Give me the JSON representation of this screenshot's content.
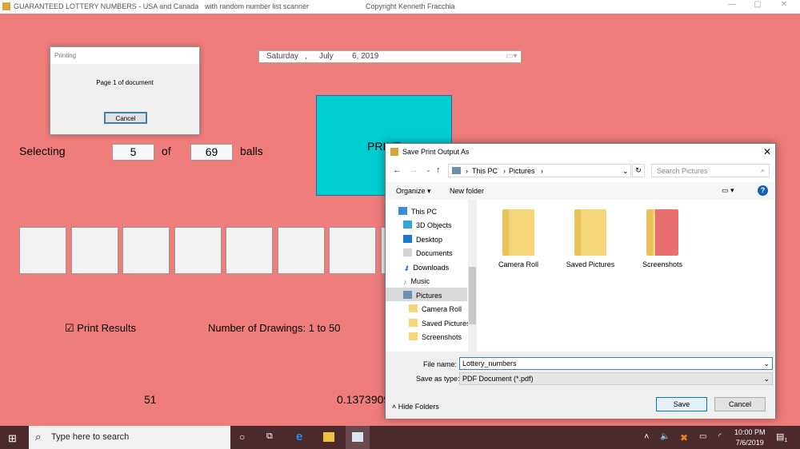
{
  "window": {
    "title": "GUARANTEED LOTTERY NUMBERS - USA and Canada",
    "subtitle": "with random number list scanner",
    "copyright": "Copyright Kenneth Fracchia"
  },
  "printing_dialog": {
    "title": "Printing",
    "message": "Page 1 of document",
    "cancel": "Cancel"
  },
  "date_picker": {
    "day": "Saturday",
    "sep": ",",
    "month": "July",
    "date": "6, 2019"
  },
  "print_button": {
    "label": "PRINT"
  },
  "selection": {
    "label": "Selecting",
    "count": "5",
    "of": "of",
    "total": "69",
    "balls": "balls"
  },
  "print_results": {
    "label": "Print Results",
    "checked": true
  },
  "drawings": {
    "label": "Number of Drawings:  1 to 50"
  },
  "bottom": {
    "left_value": "51",
    "right_value": "0.1373909"
  },
  "save_dialog": {
    "title": "Save Print Output As",
    "breadcrumb": [
      "This PC",
      "Pictures"
    ],
    "search_placeholder": "Search Pictures",
    "organize": "Organize",
    "new_folder": "New folder",
    "nav": [
      {
        "label": "This PC",
        "color": "#3a8fd8"
      },
      {
        "label": "3D Objects",
        "color": "#37a6d6"
      },
      {
        "label": "Desktop",
        "color": "#1e78d0"
      },
      {
        "label": "Documents",
        "color": "#cfd4da"
      },
      {
        "label": "Downloads",
        "color": "#2d7bd1"
      },
      {
        "label": "Music",
        "color": "#2d7bd1"
      },
      {
        "label": "Pictures",
        "color": "#6c8fb3"
      },
      {
        "label": "Camera Roll",
        "color": "#f5d57a"
      },
      {
        "label": "Saved Pictures",
        "color": "#f5d57a"
      },
      {
        "label": "Screenshots",
        "color": "#f5d57a"
      }
    ],
    "folders": [
      "Camera Roll",
      "Saved Pictures",
      "Screenshots"
    ],
    "file_name_label": "File name:",
    "file_name": "Lottery_numbers",
    "save_type_label": "Save as type:",
    "save_type": "PDF Document (*.pdf)",
    "hide_folders": "Hide Folders",
    "save": "Save",
    "cancel": "Cancel"
  },
  "taskbar": {
    "search_placeholder": "Type here to search",
    "time": "10:00 PM",
    "date": "7/6/2019",
    "notifications": "1"
  }
}
